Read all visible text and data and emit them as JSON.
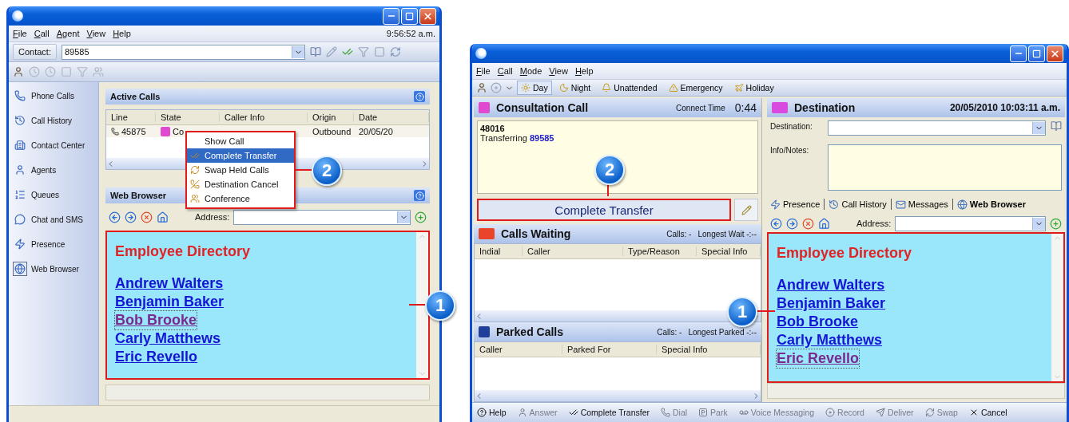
{
  "left_window": {
    "menu": [
      "File",
      "Call",
      "Agent",
      "View",
      "Help"
    ],
    "clock": "9:56:52 a.m.",
    "contact": {
      "label": "Contact:",
      "value": "89585"
    },
    "sidebar": [
      {
        "label": "Phone Calls",
        "selected": false
      },
      {
        "label": "Call History",
        "selected": false
      },
      {
        "label": "Contact Center",
        "selected": false
      },
      {
        "label": "Agents",
        "selected": false
      },
      {
        "label": "Queues",
        "selected": false
      },
      {
        "label": "Chat and SMS",
        "selected": false
      },
      {
        "label": "Presence",
        "selected": false
      },
      {
        "label": "Web Browser",
        "selected": true
      }
    ],
    "active_calls": {
      "title": "Active Calls",
      "columns": [
        "Line",
        "State",
        "Caller Info",
        "Origin",
        "Date"
      ],
      "rows": [
        {
          "line": "45875",
          "state": "Co",
          "origin": "Outbound",
          "date": "20/05/20"
        }
      ]
    },
    "context_menu": {
      "callout": "2",
      "items": [
        {
          "label": "Show Call",
          "selected": false
        },
        {
          "label": "Complete Transfer",
          "selected": true
        },
        {
          "label": "Swap Held Calls",
          "selected": false
        },
        {
          "label": "Destination Cancel",
          "selected": false
        },
        {
          "label": "Conference",
          "selected": false
        }
      ]
    },
    "web_browser": {
      "title": "Web Browser",
      "address_label": "Address:",
      "callout": "1",
      "heading": "Employee Directory",
      "links": [
        {
          "label": "Andrew Walters",
          "visited": false
        },
        {
          "label": "Benjamin Baker",
          "visited": false
        },
        {
          "label": "Bob Brooke",
          "visited": true
        },
        {
          "label": "Carly Matthews",
          "visited": false
        },
        {
          "label": "Eric Revello",
          "visited": false
        }
      ]
    }
  },
  "right_window": {
    "menu": [
      "File",
      "Call",
      "Mode",
      "View",
      "Help"
    ],
    "modes": [
      {
        "label": "Day",
        "selected": true
      },
      {
        "label": "Night",
        "selected": false
      },
      {
        "label": "Unattended",
        "selected": false
      },
      {
        "label": "Emergency",
        "selected": false
      },
      {
        "label": "Holiday",
        "selected": false
      }
    ],
    "consultation": {
      "title": "Consultation Call",
      "connect_label": "Connect Time",
      "connect_time": "0:44",
      "number": "48016",
      "status": "Transferring",
      "target": "89585",
      "action": "Complete Transfer",
      "callout": "2"
    },
    "calls_waiting": {
      "title": "Calls Waiting",
      "calls": "Calls: -",
      "longest": "Longest Wait -:--",
      "columns": [
        "Indial",
        "Caller",
        "Type/Reason",
        "Special Info"
      ]
    },
    "parked_calls": {
      "title": "Parked Calls",
      "calls": "Calls: -",
      "longest": "Longest Parked -:--",
      "columns": [
        "Caller",
        "Parked For",
        "Special Info"
      ]
    },
    "destination": {
      "title": "Destination",
      "datetime": "20/05/2010 10:03:11 a.m.",
      "destination_label": "Destination:",
      "notes_label": "Info/Notes:"
    },
    "tabs": [
      {
        "label": "Presence",
        "selected": false
      },
      {
        "label": "Call History",
        "selected": false
      },
      {
        "label": "Messages",
        "selected": false
      },
      {
        "label": "Web Browser",
        "selected": true
      }
    ],
    "web_browser": {
      "address_label": "Address:",
      "callout": "1",
      "heading": "Employee Directory",
      "links": [
        {
          "label": "Andrew Walters",
          "visited": false
        },
        {
          "label": "Benjamin Baker",
          "visited": false
        },
        {
          "label": "Bob Brooke",
          "visited": false
        },
        {
          "label": "Carly Matthews",
          "visited": false
        },
        {
          "label": "Eric Revello",
          "visited": true
        }
      ]
    },
    "actions": [
      {
        "label": "Help",
        "disabled": false
      },
      {
        "label": "Answer",
        "disabled": true
      },
      {
        "label": "Complete Transfer",
        "disabled": false
      },
      {
        "label": "Dial",
        "disabled": true
      },
      {
        "label": "Park",
        "disabled": true
      },
      {
        "label": "Voice Messaging",
        "disabled": true
      },
      {
        "label": "Record",
        "disabled": true
      },
      {
        "label": "Deliver",
        "disabled": true
      },
      {
        "label": "Swap",
        "disabled": true
      },
      {
        "label": "Cancel",
        "disabled": false
      }
    ]
  }
}
